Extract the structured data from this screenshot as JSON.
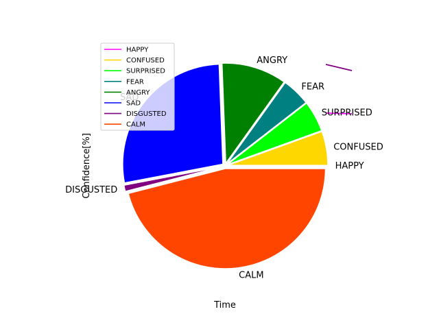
{
  "chart_data": {
    "type": "pie",
    "xlabel": "Time",
    "ylabel": "Confidence[%]",
    "legend_position": "upper-left",
    "slices": [
      {
        "label": "HAPPY",
        "value": 0.0,
        "color": "#ff00ff"
      },
      {
        "label": "CONFUSED",
        "value": 5.5,
        "color": "#ffd700"
      },
      {
        "label": "SURPRISED",
        "value": 5.0,
        "color": "#00ff00"
      },
      {
        "label": "FEAR",
        "value": 4.6,
        "color": "#008080"
      },
      {
        "label": "ANGRY",
        "value": 10.5,
        "color": "#008000"
      },
      {
        "label": "SAD",
        "value": 27.4,
        "color": "#0000ff"
      },
      {
        "label": "DISGUSTED",
        "value": 1.0,
        "color": "#800080"
      },
      {
        "label": "CALM",
        "value": 46.0,
        "color": "#ff4500"
      }
    ],
    "legend": [
      "HAPPY",
      "CONFUSED",
      "SURPRISED",
      "FEAR",
      "ANGRY",
      "SAD",
      "DISGUSTED",
      "CALM"
    ]
  }
}
